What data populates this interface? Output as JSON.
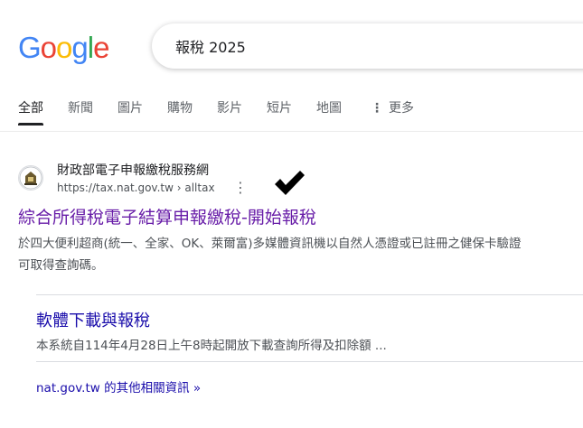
{
  "logo": {
    "letters": [
      "G",
      "o",
      "o",
      "g",
      "l",
      "e"
    ],
    "colors": [
      "#4285F4",
      "#EA4335",
      "#FBBC05",
      "#4285F4",
      "#34A853",
      "#EA4335"
    ]
  },
  "search": {
    "query": "報稅 2025"
  },
  "tabs": [
    {
      "label": "全部",
      "active": true
    },
    {
      "label": "新聞"
    },
    {
      "label": "圖片"
    },
    {
      "label": "購物"
    },
    {
      "label": "影片"
    },
    {
      "label": "短片"
    },
    {
      "label": "地圖"
    },
    {
      "label": "更多"
    }
  ],
  "result": {
    "site_name": "財政部電子申報繳稅服務網",
    "url": "https://tax.nat.gov.tw › alltax",
    "title": "綜合所得稅電子結算申報繳稅-開始報稅",
    "snippet_line1": "於四大便利超商(統一、全家、OK、萊爾富)多媒體資訊機以自然人憑證或已註冊之健保卡驗證",
    "snippet_line2": "可取得查詢碼。",
    "title_color": "#681da8"
  },
  "sitelink": {
    "title": "軟體下載與報稅",
    "description": "本系統自114年4月28日上午8時起開放下載查詢所得及扣除額 ..."
  },
  "more_results": "nat.gov.tw 的其他相關資訊 »",
  "icons": {
    "annotation": "checkmark-icon",
    "menu": "more-vert-icon",
    "favicon": "ministry-seal-icon"
  }
}
